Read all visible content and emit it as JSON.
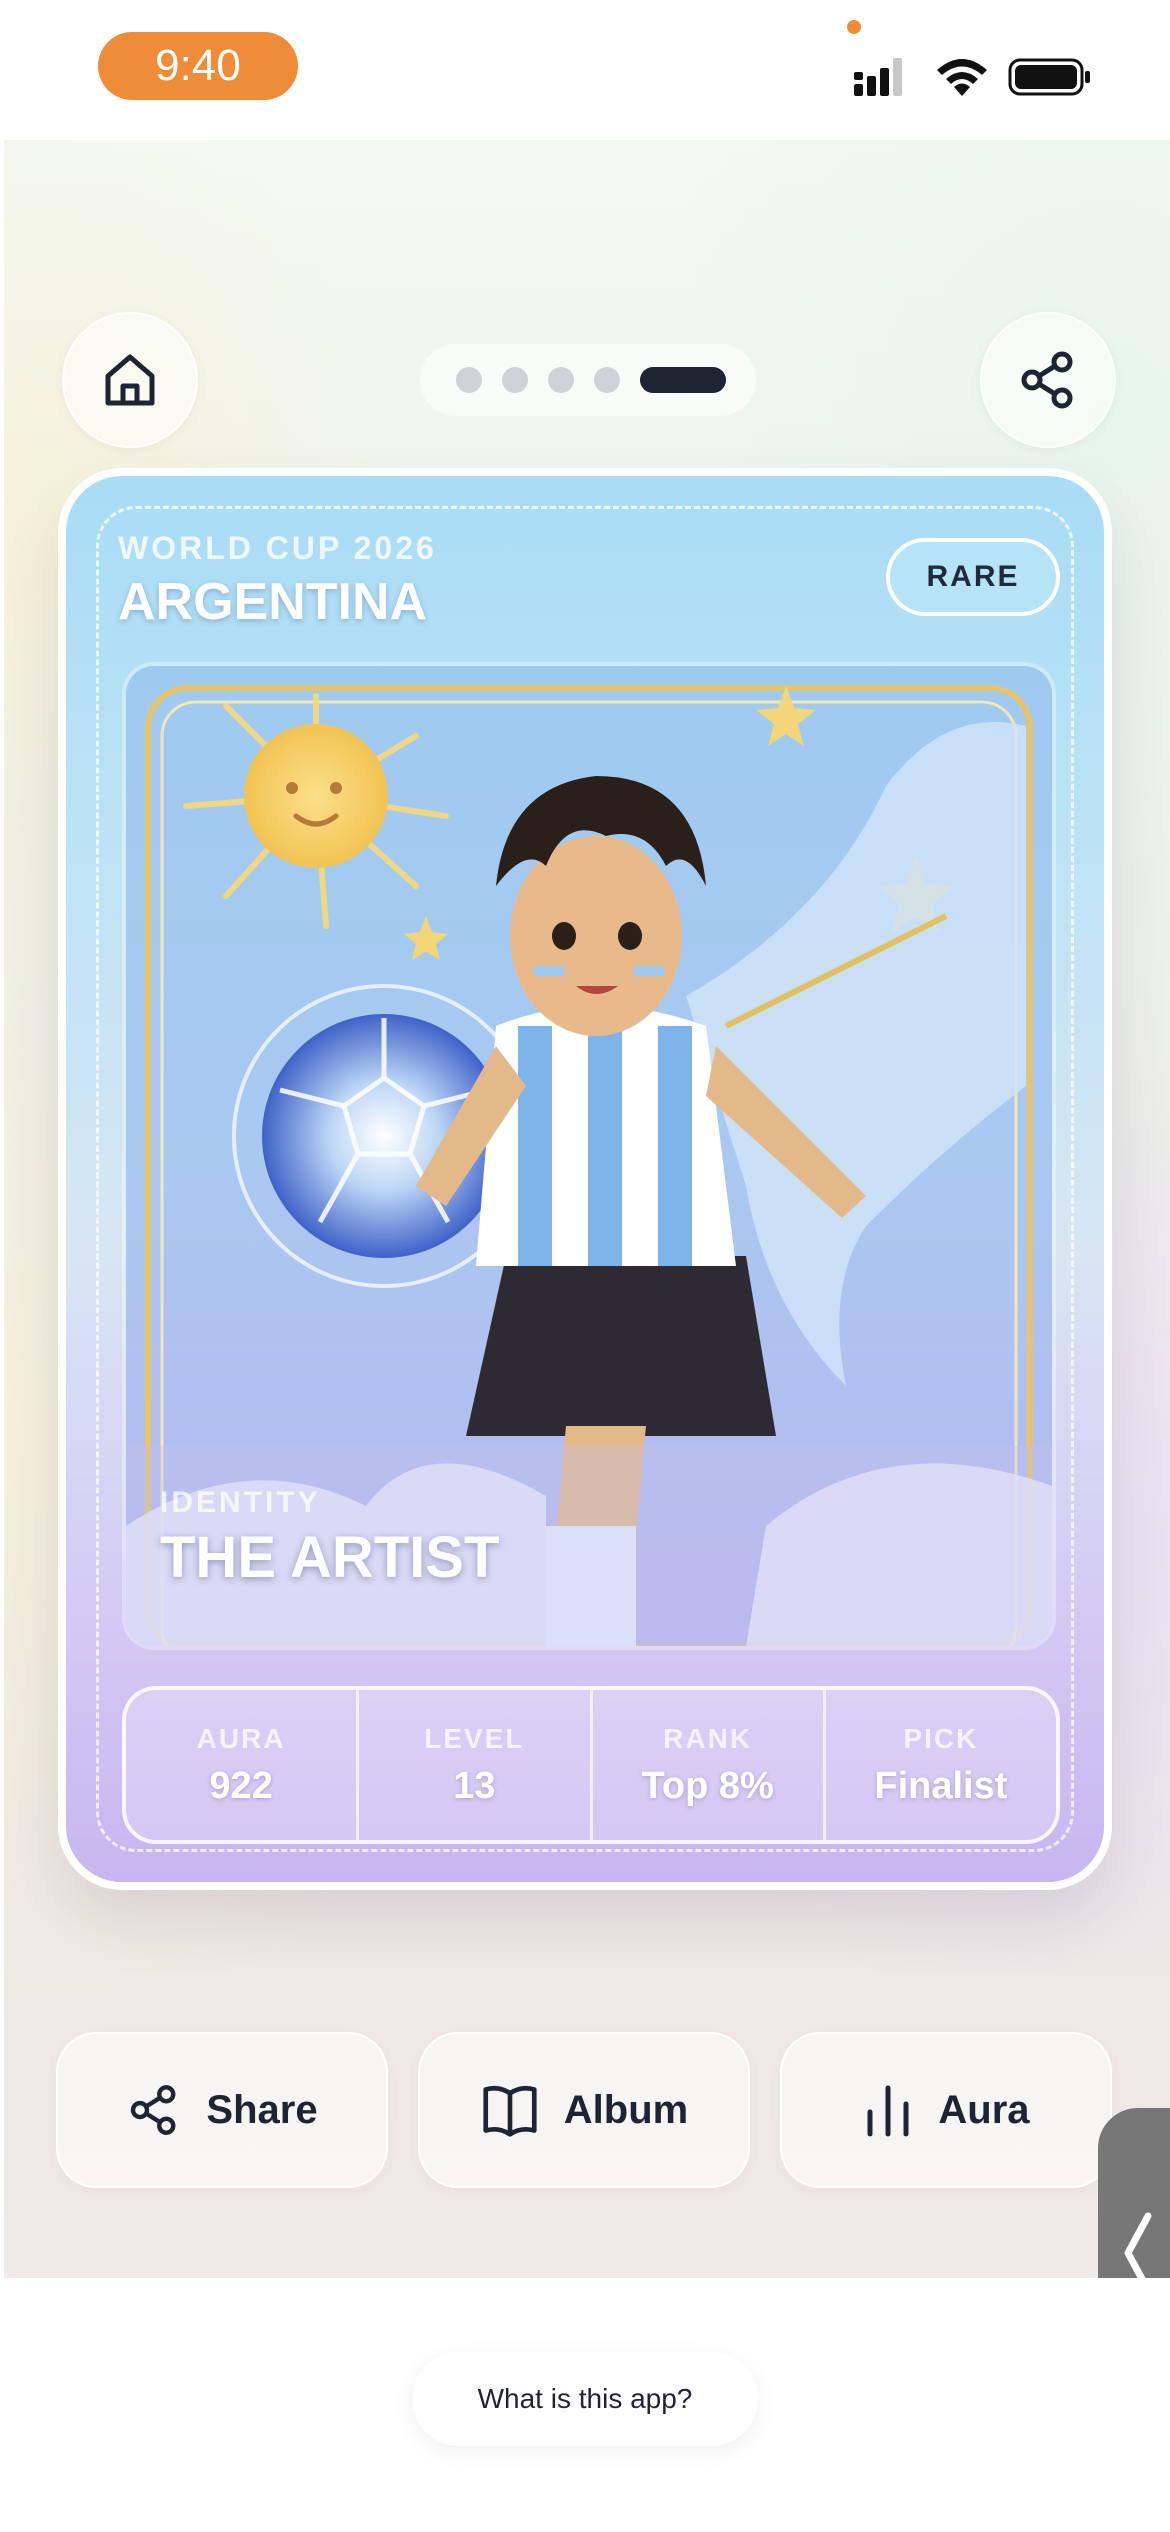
{
  "status_bar": {
    "time": "9:40"
  },
  "nav": {
    "home_icon": "home-icon",
    "share_icon": "share-icon",
    "pager": {
      "total": 5,
      "active_index": 4
    }
  },
  "card": {
    "eyebrow": "WORLD CUP 2026",
    "title": "ARGENTINA",
    "rarity": "RARE",
    "identity_label": "IDENTITY",
    "identity_value": "THE ARTIST",
    "stats": [
      {
        "label": "AURA",
        "value": "922"
      },
      {
        "label": "LEVEL",
        "value": "13"
      },
      {
        "label": "RANK",
        "value": "Top 8%"
      },
      {
        "label": "PICK",
        "value": "Finalist"
      }
    ],
    "colors": {
      "sky_blue": "#a9dcf6",
      "lavender": "#c7b6f0"
    }
  },
  "actions": [
    {
      "label": "Share",
      "icon": "share-icon"
    },
    {
      "label": "Album",
      "icon": "book-icon"
    },
    {
      "label": "Aura",
      "icon": "bar-chart-icon"
    }
  ],
  "footer": {
    "help_link": "What is this app?"
  },
  "colors": {
    "accent_orange": "#ef8c38",
    "ink": "#1f2433"
  }
}
